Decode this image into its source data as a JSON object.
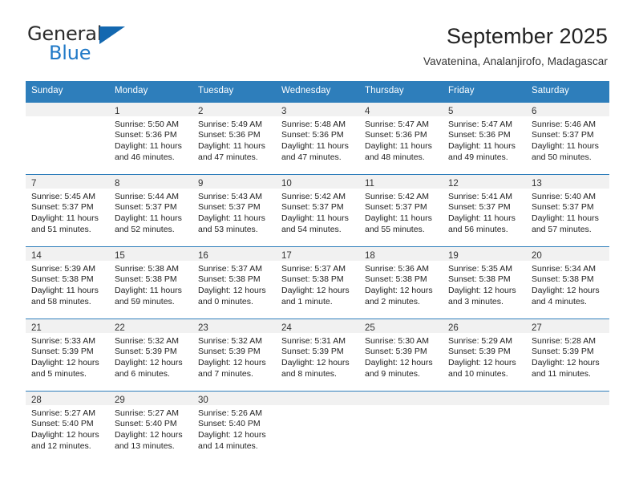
{
  "logo": {
    "text_primary": "General",
    "text_secondary": "Blue",
    "triangle_icon": "triangle-icon",
    "color_primary": "#2b2b2b",
    "color_secondary": "#2079c7"
  },
  "header": {
    "title": "September 2025",
    "subtitle": "Vavatenina, Analanjirofo, Madagascar"
  },
  "theme": {
    "header_blue": "#2e7ebb",
    "day_band_gray": "#f1f1f1",
    "text_dark": "#222222"
  },
  "weekdays": [
    "Sunday",
    "Monday",
    "Tuesday",
    "Wednesday",
    "Thursday",
    "Friday",
    "Saturday"
  ],
  "weeks": [
    [
      {
        "day": "",
        "sunrise": "",
        "sunset": "",
        "daylight_line1": "",
        "daylight_line2": ""
      },
      {
        "day": "1",
        "sunrise": "Sunrise: 5:50 AM",
        "sunset": "Sunset: 5:36 PM",
        "daylight_line1": "Daylight: 11 hours",
        "daylight_line2": "and 46 minutes."
      },
      {
        "day": "2",
        "sunrise": "Sunrise: 5:49 AM",
        "sunset": "Sunset: 5:36 PM",
        "daylight_line1": "Daylight: 11 hours",
        "daylight_line2": "and 47 minutes."
      },
      {
        "day": "3",
        "sunrise": "Sunrise: 5:48 AM",
        "sunset": "Sunset: 5:36 PM",
        "daylight_line1": "Daylight: 11 hours",
        "daylight_line2": "and 47 minutes."
      },
      {
        "day": "4",
        "sunrise": "Sunrise: 5:47 AM",
        "sunset": "Sunset: 5:36 PM",
        "daylight_line1": "Daylight: 11 hours",
        "daylight_line2": "and 48 minutes."
      },
      {
        "day": "5",
        "sunrise": "Sunrise: 5:47 AM",
        "sunset": "Sunset: 5:36 PM",
        "daylight_line1": "Daylight: 11 hours",
        "daylight_line2": "and 49 minutes."
      },
      {
        "day": "6",
        "sunrise": "Sunrise: 5:46 AM",
        "sunset": "Sunset: 5:37 PM",
        "daylight_line1": "Daylight: 11 hours",
        "daylight_line2": "and 50 minutes."
      }
    ],
    [
      {
        "day": "7",
        "sunrise": "Sunrise: 5:45 AM",
        "sunset": "Sunset: 5:37 PM",
        "daylight_line1": "Daylight: 11 hours",
        "daylight_line2": "and 51 minutes."
      },
      {
        "day": "8",
        "sunrise": "Sunrise: 5:44 AM",
        "sunset": "Sunset: 5:37 PM",
        "daylight_line1": "Daylight: 11 hours",
        "daylight_line2": "and 52 minutes."
      },
      {
        "day": "9",
        "sunrise": "Sunrise: 5:43 AM",
        "sunset": "Sunset: 5:37 PM",
        "daylight_line1": "Daylight: 11 hours",
        "daylight_line2": "and 53 minutes."
      },
      {
        "day": "10",
        "sunrise": "Sunrise: 5:42 AM",
        "sunset": "Sunset: 5:37 PM",
        "daylight_line1": "Daylight: 11 hours",
        "daylight_line2": "and 54 minutes."
      },
      {
        "day": "11",
        "sunrise": "Sunrise: 5:42 AM",
        "sunset": "Sunset: 5:37 PM",
        "daylight_line1": "Daylight: 11 hours",
        "daylight_line2": "and 55 minutes."
      },
      {
        "day": "12",
        "sunrise": "Sunrise: 5:41 AM",
        "sunset": "Sunset: 5:37 PM",
        "daylight_line1": "Daylight: 11 hours",
        "daylight_line2": "and 56 minutes."
      },
      {
        "day": "13",
        "sunrise": "Sunrise: 5:40 AM",
        "sunset": "Sunset: 5:37 PM",
        "daylight_line1": "Daylight: 11 hours",
        "daylight_line2": "and 57 minutes."
      }
    ],
    [
      {
        "day": "14",
        "sunrise": "Sunrise: 5:39 AM",
        "sunset": "Sunset: 5:38 PM",
        "daylight_line1": "Daylight: 11 hours",
        "daylight_line2": "and 58 minutes."
      },
      {
        "day": "15",
        "sunrise": "Sunrise: 5:38 AM",
        "sunset": "Sunset: 5:38 PM",
        "daylight_line1": "Daylight: 11 hours",
        "daylight_line2": "and 59 minutes."
      },
      {
        "day": "16",
        "sunrise": "Sunrise: 5:37 AM",
        "sunset": "Sunset: 5:38 PM",
        "daylight_line1": "Daylight: 12 hours",
        "daylight_line2": "and 0 minutes."
      },
      {
        "day": "17",
        "sunrise": "Sunrise: 5:37 AM",
        "sunset": "Sunset: 5:38 PM",
        "daylight_line1": "Daylight: 12 hours",
        "daylight_line2": "and 1 minute."
      },
      {
        "day": "18",
        "sunrise": "Sunrise: 5:36 AM",
        "sunset": "Sunset: 5:38 PM",
        "daylight_line1": "Daylight: 12 hours",
        "daylight_line2": "and 2 minutes."
      },
      {
        "day": "19",
        "sunrise": "Sunrise: 5:35 AM",
        "sunset": "Sunset: 5:38 PM",
        "daylight_line1": "Daylight: 12 hours",
        "daylight_line2": "and 3 minutes."
      },
      {
        "day": "20",
        "sunrise": "Sunrise: 5:34 AM",
        "sunset": "Sunset: 5:38 PM",
        "daylight_line1": "Daylight: 12 hours",
        "daylight_line2": "and 4 minutes."
      }
    ],
    [
      {
        "day": "21",
        "sunrise": "Sunrise: 5:33 AM",
        "sunset": "Sunset: 5:39 PM",
        "daylight_line1": "Daylight: 12 hours",
        "daylight_line2": "and 5 minutes."
      },
      {
        "day": "22",
        "sunrise": "Sunrise: 5:32 AM",
        "sunset": "Sunset: 5:39 PM",
        "daylight_line1": "Daylight: 12 hours",
        "daylight_line2": "and 6 minutes."
      },
      {
        "day": "23",
        "sunrise": "Sunrise: 5:32 AM",
        "sunset": "Sunset: 5:39 PM",
        "daylight_line1": "Daylight: 12 hours",
        "daylight_line2": "and 7 minutes."
      },
      {
        "day": "24",
        "sunrise": "Sunrise: 5:31 AM",
        "sunset": "Sunset: 5:39 PM",
        "daylight_line1": "Daylight: 12 hours",
        "daylight_line2": "and 8 minutes."
      },
      {
        "day": "25",
        "sunrise": "Sunrise: 5:30 AM",
        "sunset": "Sunset: 5:39 PM",
        "daylight_line1": "Daylight: 12 hours",
        "daylight_line2": "and 9 minutes."
      },
      {
        "day": "26",
        "sunrise": "Sunrise: 5:29 AM",
        "sunset": "Sunset: 5:39 PM",
        "daylight_line1": "Daylight: 12 hours",
        "daylight_line2": "and 10 minutes."
      },
      {
        "day": "27",
        "sunrise": "Sunrise: 5:28 AM",
        "sunset": "Sunset: 5:39 PM",
        "daylight_line1": "Daylight: 12 hours",
        "daylight_line2": "and 11 minutes."
      }
    ],
    [
      {
        "day": "28",
        "sunrise": "Sunrise: 5:27 AM",
        "sunset": "Sunset: 5:40 PM",
        "daylight_line1": "Daylight: 12 hours",
        "daylight_line2": "and 12 minutes."
      },
      {
        "day": "29",
        "sunrise": "Sunrise: 5:27 AM",
        "sunset": "Sunset: 5:40 PM",
        "daylight_line1": "Daylight: 12 hours",
        "daylight_line2": "and 13 minutes."
      },
      {
        "day": "30",
        "sunrise": "Sunrise: 5:26 AM",
        "sunset": "Sunset: 5:40 PM",
        "daylight_line1": "Daylight: 12 hours",
        "daylight_line2": "and 14 minutes."
      },
      {
        "day": "",
        "sunrise": "",
        "sunset": "",
        "daylight_line1": "",
        "daylight_line2": ""
      },
      {
        "day": "",
        "sunrise": "",
        "sunset": "",
        "daylight_line1": "",
        "daylight_line2": ""
      },
      {
        "day": "",
        "sunrise": "",
        "sunset": "",
        "daylight_line1": "",
        "daylight_line2": ""
      },
      {
        "day": "",
        "sunrise": "",
        "sunset": "",
        "daylight_line1": "",
        "daylight_line2": ""
      }
    ]
  ]
}
